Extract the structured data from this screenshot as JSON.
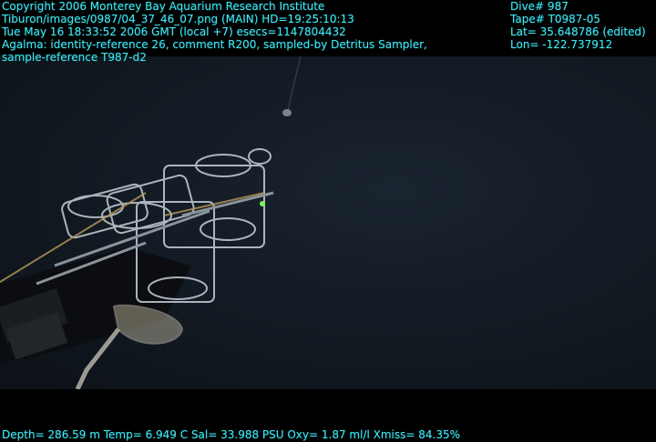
{
  "overlay": {
    "left_lines": [
      "Copyright 2006 Monterey Bay Aquarium Research Institute",
      "Tiburon/images/0987/04_37_46_07.png (MAIN)  HD=19:25:10:13",
      "Tue May 16 18:33:52 2006 GMT (local +7)  esecs=1147804432",
      "Agalma: identity-reference 26, comment R200, sampled-by Detritus Sampler,",
      "sample-reference T987-d2"
    ],
    "right_lines": [
      "Dive# 987",
      "Tape# T0987-05",
      "Lat= 35.648786 (edited)",
      "Lon= -122.737912"
    ],
    "bottom_line": "Depth= 286.59 m  Temp= 6.949 C  Sal= 33.988 PSU  Oxy= 1.87 ml/l  Xmiss= 84.35%"
  },
  "colors": {
    "overlay_text": "#3fe7f3",
    "water": "#131b24",
    "equipment": "#c7cfd8"
  }
}
